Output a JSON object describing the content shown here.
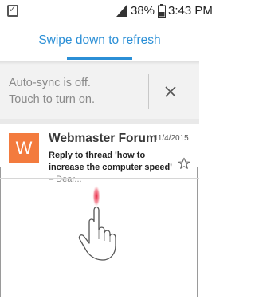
{
  "status_bar": {
    "battery_percent": "38%",
    "time": "3:43 PM"
  },
  "header": {
    "swipe_text": "Swipe down to refresh",
    "accent_color": "#2b8fd6"
  },
  "autosync_banner": {
    "line1": "Auto-sync is off.",
    "line2": "Touch to turn on.",
    "dismiss_icon": "close-icon"
  },
  "emails": [
    {
      "avatar_letter": "W",
      "avatar_color": "#f37b3e",
      "sender": "Webmaster Forum",
      "date": "11/4/2015",
      "subject": "Reply to thread 'how to increase the computer speed'",
      "preview": " – Dear..."
    }
  ],
  "overlay": {
    "icon": "pointing-hand-icon"
  }
}
